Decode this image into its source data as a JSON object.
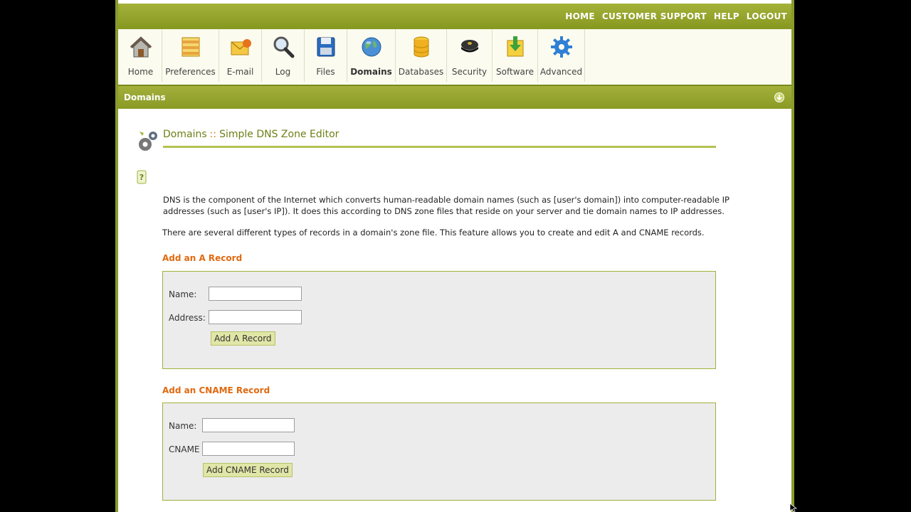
{
  "top_links": [
    "HOME",
    "CUSTOMER SUPPORT",
    "HELP",
    "LOGOUT"
  ],
  "toolbar": [
    {
      "label": "Home",
      "icon": "house-icon"
    },
    {
      "label": "Preferences",
      "icon": "preferences-icon"
    },
    {
      "label": "E-mail",
      "icon": "email-icon"
    },
    {
      "label": "Log",
      "icon": "magnifier-icon"
    },
    {
      "label": "Files",
      "icon": "floppy-disk-icon"
    },
    {
      "label": "Domains",
      "icon": "globe-icon"
    },
    {
      "label": "Databases",
      "icon": "database-icon"
    },
    {
      "label": "Security",
      "icon": "security-cap-icon"
    },
    {
      "label": "Software",
      "icon": "software-download-icon"
    },
    {
      "label": "Advanced",
      "icon": "gear-icon"
    }
  ],
  "section_title": "Domains",
  "page": {
    "title": "Domains",
    "separator": "::",
    "subtitle": "Simple DNS Zone Editor",
    "para1_line1": "DNS is the component of the Internet which converts human-readable domain names (such as [user's domain]) into computer-readable IP",
    "para1_line2": "addresses (such as [user's IP]). It does this according to DNS zone files that reside on your server and tie domain names to IP addresses.",
    "para2": "There are several different types of records in a domain's zone file. This feature allows you to create and edit A and CNAME records."
  },
  "a_record": {
    "heading": "Add an A Record",
    "name_label": "Name:",
    "name_value": "",
    "address_label": "Address:",
    "address_value": "",
    "button": "Add A Record"
  },
  "cname_record": {
    "heading": "Add an CNAME Record",
    "name_label": "Name:",
    "name_value": "",
    "cname_label": "CNAME",
    "cname_value": "",
    "button": "Add CNAME Record"
  },
  "colors": {
    "accent": "#8a9a25",
    "heading_orange": "#e06a10",
    "title_green": "#6f7f15"
  }
}
